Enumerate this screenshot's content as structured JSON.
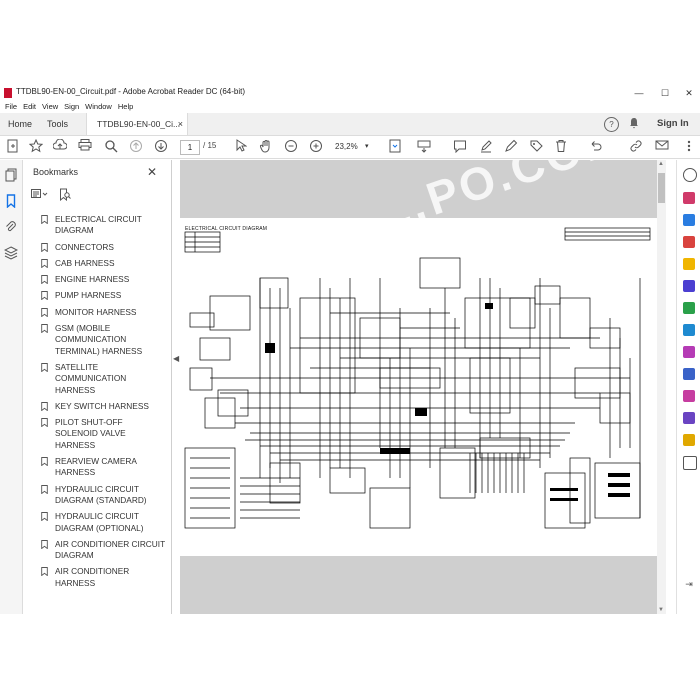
{
  "window": {
    "title": "TTDBL90-EN-00_Circuit.pdf - Adobe Acrobat Reader DC (64-bit)",
    "controls": {
      "minimize": "—",
      "maximize": "☐",
      "close": "✕"
    }
  },
  "menu": [
    "File",
    "Edit",
    "View",
    "Sign",
    "Window",
    "Help"
  ],
  "tabs": {
    "home": "Home",
    "tools": "Tools",
    "document": "TTDBL90-EN-00_Ci...",
    "close": "×"
  },
  "header_right": {
    "help": "?",
    "bell": "🔔",
    "sign_in": "Sign In"
  },
  "toolbar": {
    "page_current": "1",
    "page_total": "/ 15",
    "zoom": "23,2%"
  },
  "bookmarks": {
    "title": "Bookmarks",
    "close": "✕",
    "items": [
      "ELECTRICAL CIRCUIT DIAGRAM",
      "CONNECTORS",
      "CAB HARNESS",
      "ENGINE HARNESS",
      "PUMP HARNESS",
      "MONITOR HARNESS",
      "GSM (MOBILE COMMUNICATION TERMINAL) HARNESS",
      "SATELLITE COMMUNICATION HARNESS",
      "KEY SWITCH HARNESS",
      "PILOT SHUT-OFF SOLENOID VALVE HARNESS",
      "REARVIEW CAMERA HARNESS",
      "HYDRAULIC CIRCUIT DIAGRAM (STANDARD)",
      "HYDRAULIC CIRCUIT DIAGRAM (OPTIONAL)",
      "AIR CONDITIONER CIRCUIT DIAGRAM",
      "AIR CONDITIONER HARNESS"
    ]
  },
  "document": {
    "diagram_title": "ELECTRICAL CIRCUIT DIAGRAM",
    "watermark": "…PO.COM"
  },
  "colors": {
    "accent": "#1473e6",
    "pdf_red": "#c8102e",
    "canvas_gray": "#cfcfcf"
  }
}
